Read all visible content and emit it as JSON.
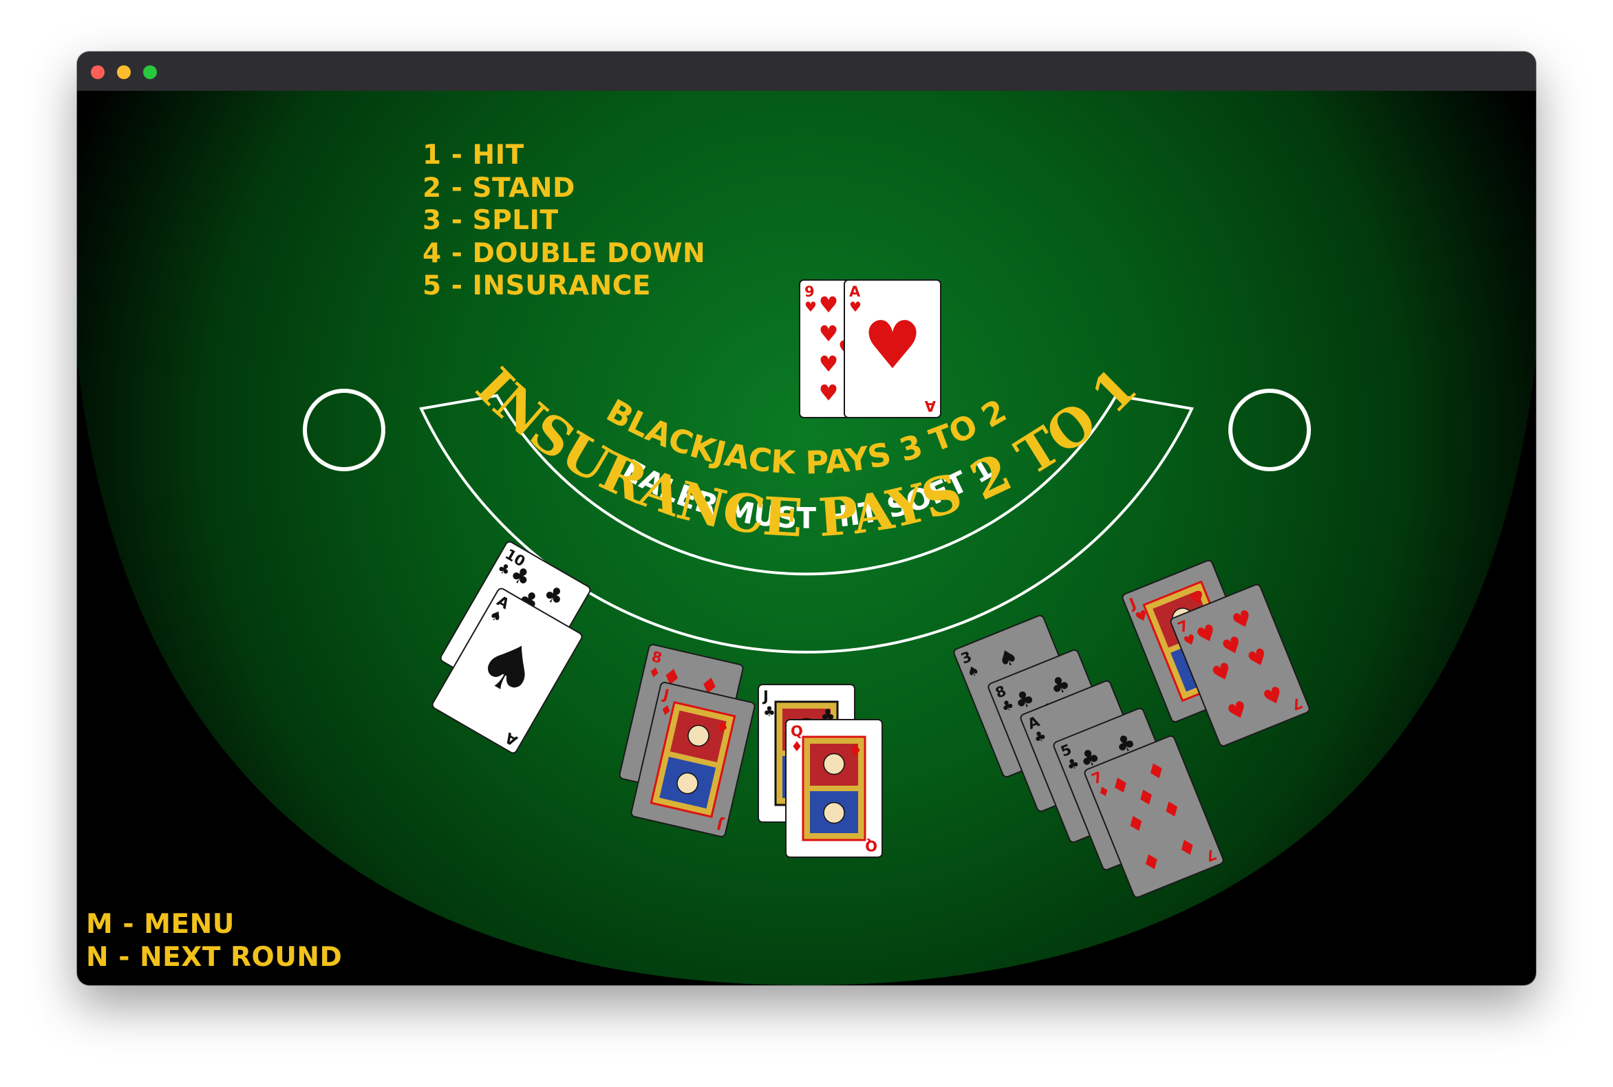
{
  "window": {
    "controls": [
      "close",
      "minimize",
      "maximize"
    ]
  },
  "actions": [
    {
      "key": "1",
      "text": "1 - HIT"
    },
    {
      "key": "2",
      "text": "2 - STAND"
    },
    {
      "key": "3",
      "text": "3 - SPLIT"
    },
    {
      "key": "4",
      "text": "4 - DOUBLE DOWN"
    },
    {
      "key": "5",
      "text": "5 - INSURANCE"
    }
  ],
  "menu": {
    "menu_text": "M - MENU",
    "next_round_text": "N - NEXT ROUND"
  },
  "table": {
    "felt_color": "#046d1c",
    "line_color": "#ffffff",
    "text_color": "#f2c21b",
    "blackjack_text": "BLACKJACK PAYS 3 TO 2",
    "dealer_rule_text": "DEALER MUST HIT SOFT 17",
    "insurance_text": "INSURANCE PAYS 2 TO 1"
  },
  "hands": {
    "dealer": [
      {
        "rank": "9",
        "suit": "hearts"
      },
      {
        "rank": "A",
        "suit": "hearts"
      }
    ],
    "seat_1": [
      {
        "rank": "10",
        "suit": "clubs"
      },
      {
        "rank": "A",
        "suit": "spades"
      }
    ],
    "seat_2": [
      {
        "rank": "8",
        "suit": "diamonds"
      },
      {
        "rank": "J",
        "suit": "diamonds"
      }
    ],
    "seat_3": [
      {
        "rank": "J",
        "suit": "clubs"
      },
      {
        "rank": "Q",
        "suit": "diamonds"
      }
    ],
    "seat_4": [
      {
        "rank": "3",
        "suit": "spades"
      },
      {
        "rank": "8",
        "suit": "clubs"
      },
      {
        "rank": "A",
        "suit": "clubs"
      },
      {
        "rank": "5",
        "suit": "clubs"
      },
      {
        "rank": "7",
        "suit": "diamonds"
      }
    ],
    "seat_5": [
      {
        "rank": "J",
        "suit": "hearts"
      },
      {
        "rank": "7",
        "suit": "hearts"
      }
    ]
  }
}
